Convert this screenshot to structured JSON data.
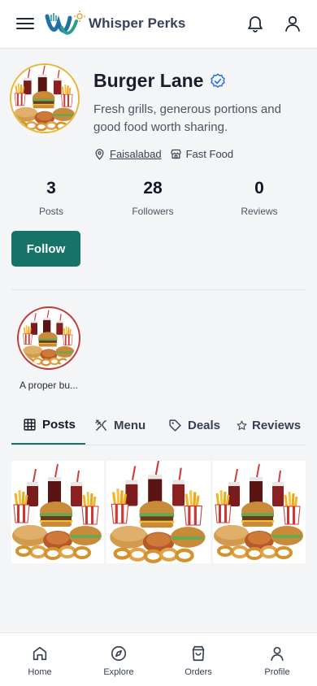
{
  "header": {
    "brand": "Whisper Perks",
    "menu_icon": "hamburger-icon",
    "notification_icon": "bell-icon",
    "account_icon": "user-icon"
  },
  "profile": {
    "name": "Burger Lane",
    "verified_icon": "verified-badge-icon",
    "tagline": "Fresh grills, generous portions and good food worth sharing.",
    "location": "Faisalabad",
    "category": "Fast Food",
    "accent_color": "#157467",
    "follow_label": "Follow"
  },
  "stats": [
    {
      "value": "3",
      "label": "Posts"
    },
    {
      "value": "28",
      "label": "Followers"
    },
    {
      "value": "0",
      "label": "Reviews"
    }
  ],
  "highlights": [
    {
      "caption": "A proper bu..."
    }
  ],
  "tabs": [
    {
      "label": "Posts",
      "icon": "grid-icon",
      "active": true
    },
    {
      "label": "Menu",
      "icon": "utensils-icon",
      "active": false
    },
    {
      "label": "Deals",
      "icon": "tag-icon",
      "active": false
    },
    {
      "label": "Reviews",
      "icon": "star-icon",
      "active": false
    }
  ],
  "nav": [
    {
      "label": "Home",
      "icon": "home-icon"
    },
    {
      "label": "Explore",
      "icon": "compass-icon"
    },
    {
      "label": "Orders",
      "icon": "shopping-bag-icon"
    },
    {
      "label": "Profile",
      "icon": "user-icon"
    }
  ]
}
